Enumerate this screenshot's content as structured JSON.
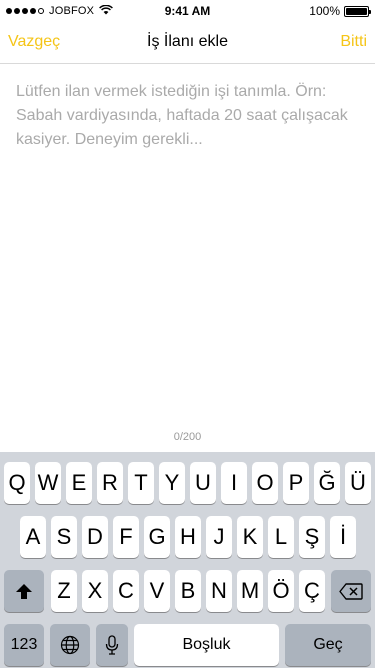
{
  "status_bar": {
    "carrier": "JOBFOX",
    "time": "9:41 AM",
    "battery": "100%",
    "battery_level": 1.0,
    "signal_bars": 4
  },
  "nav": {
    "cancel_label": "Vazgeç",
    "title": "İş İlanı ekle",
    "done_label": "Bitti",
    "accent_color": "#f5c518"
  },
  "editor": {
    "placeholder": "Lütfen ilan vermek istediğin işi tanımla. Örn: Sabah vardiyasında, haftada 20 saat çalışacak kasiyer. Deneyim gerekli...",
    "value": "",
    "counter": "0/200"
  },
  "keyboard": {
    "row1": [
      "Q",
      "W",
      "E",
      "R",
      "T",
      "Y",
      "U",
      "I",
      "O",
      "P",
      "Ğ",
      "Ü"
    ],
    "row2": [
      "A",
      "S",
      "D",
      "F",
      "G",
      "H",
      "J",
      "K",
      "L",
      "Ş",
      "İ"
    ],
    "row3": [
      "Z",
      "X",
      "C",
      "V",
      "B",
      "N",
      "M",
      "Ö",
      "Ç"
    ],
    "numbers_label": "123",
    "space_label": "Boşluk",
    "return_label": "Geç",
    "icons": {
      "shift": "shift-icon",
      "backspace": "backspace-icon",
      "globe": "globe-icon",
      "mic": "microphone-icon"
    }
  }
}
